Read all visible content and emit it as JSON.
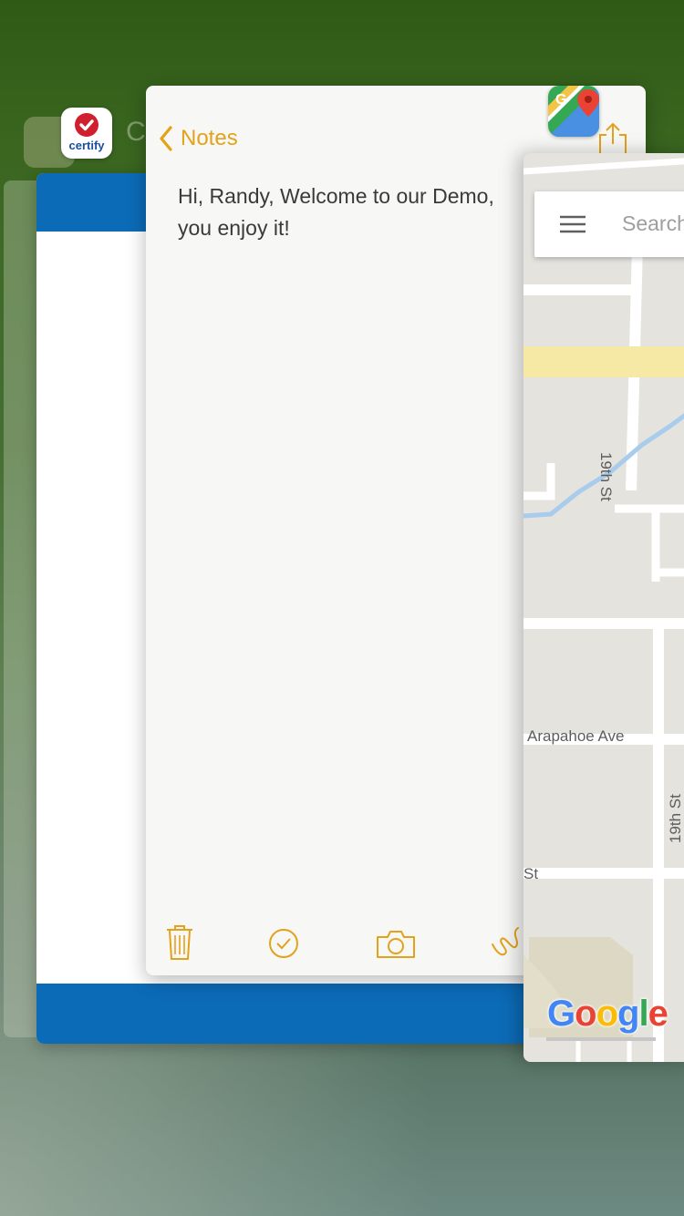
{
  "background_cards": {
    "ghost_letter": "C"
  },
  "certify": {
    "icon_label": "certify",
    "accent_color": "#0c6bb7",
    "brand_red": "#d0202e"
  },
  "notes": {
    "back_label": "Notes",
    "body_text": "Hi, Randy, Welcome to our Demo,\nyou enjoy it!",
    "accent_color": "#e3a21a",
    "toolbar": [
      "trash-icon",
      "checklist-icon",
      "camera-icon",
      "sketch-icon"
    ]
  },
  "maps": {
    "search_placeholder": "Search",
    "streets": {
      "nineteenth_upper": "19th St",
      "arapahoe": "Arapahoe Ave",
      "nineteenth_lower": "19th St",
      "st_fragment": "St"
    },
    "logo_letters": [
      "G",
      "o",
      "o",
      "g",
      "l",
      "e"
    ],
    "logo_colors": [
      "#4285f4",
      "#ea4335",
      "#fbbc05",
      "#4285f4",
      "#34a853",
      "#ea4335"
    ]
  }
}
